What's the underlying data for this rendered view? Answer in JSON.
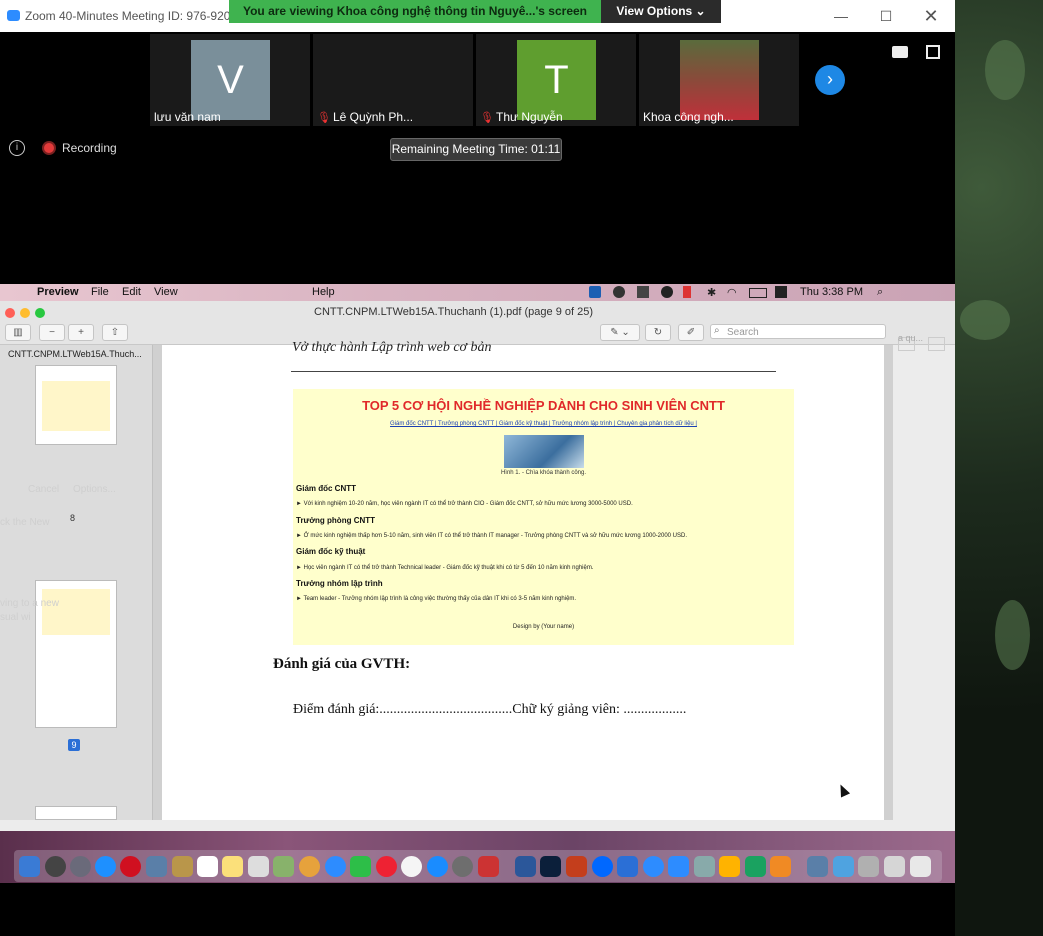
{
  "zoom": {
    "window_title": "Zoom 40-Minutes Meeting ID: 976-920",
    "viewing_banner": "You are viewing Khoa công nghệ thông tin Nguyê...'s screen",
    "view_options": "View Options ⌄",
    "participants": [
      {
        "initial": "V",
        "name": "lưu văn nam",
        "color": "#7a8f9a",
        "muted": false
      },
      {
        "initial": "",
        "name": "Lê Quỳnh Ph...",
        "color": "#1a1a1a",
        "muted": true
      },
      {
        "initial": "T",
        "name": "Thư Nguyễn",
        "color": "#5f9e2f",
        "muted": true
      },
      {
        "initial": "",
        "name": "Khoa công ngh...",
        "color": "#b33",
        "muted": false
      }
    ],
    "recording_label": "Recording",
    "remaining_time": "Remaining Meeting Time: 01:11",
    "next_icon": "chevron-right-icon"
  },
  "menubar": {
    "app": "Preview",
    "items": [
      "File",
      "Edit",
      "View",
      "Help"
    ],
    "clock": "Thu 3:38 PM"
  },
  "preview": {
    "title": "CNTT.CNPM.LTWeb15A.Thuchanh (1).pdf (page 9 of 25)",
    "search_placeholder": "Search",
    "sidebar_header": "CNTT.CNPM.LTWeb15A.Thuch...",
    "page_label_8": "8",
    "page_label_9": "9",
    "ghost": {
      "cancel": "Cancel",
      "options": "Options...",
      "new": "ck the New",
      "moving": "ving to a new",
      "visual": "sual wi"
    },
    "right_ghost": "a qu..."
  },
  "document": {
    "header": "Vở thực hành Lập trình web cơ bản",
    "box_title": "TOP 5 CƠ HỘI NGHỀ NGHIỆP DÀNH CHO SINH VIÊN CNTT",
    "box_links": "Giám đốc CNTT | Trưởng phòng CNTT | Giám đốc kỹ thuật | Trưởng nhóm lập trình | Chuyên gia phân tích dữ liệu |",
    "caption": "Hình 1. - Chìa khóa thành công.",
    "sections": [
      {
        "heading": "Giám đốc CNTT",
        "text": "► Với kinh nghiệm 10-20 năm, học viên ngành IT có thể trở thành CIO - Giám đốc CNTT, sở hữu mức lương 3000-5000 USD."
      },
      {
        "heading": "Trưởng phòng CNTT",
        "text": "► Ở mức kinh nghiệm thấp hơn 5-10 năm, sinh viên IT có thể trở thành IT manager - Trưởng phòng CNTT và sở hữu mức lương 1000-2000 USD."
      },
      {
        "heading": "Giám đốc kỹ thuật",
        "text": "► Học viên ngành IT có thể trở thành Technical leader - Giám đốc kỹ thuật khi có từ 5 đến 10 năm kinh nghiệm."
      },
      {
        "heading": "Trưởng nhóm lập trình",
        "text": "► Team leader - Trưởng nhóm lập trình là công việc thường thấy của dân IT khi có 3-5 năm kinh nghiệm."
      }
    ],
    "design_by": "Design by (Your name)",
    "eval_title": "Đánh giá của GVTH:",
    "eval_line": "Điểm đánh giá:......................................Chữ ký giảng viên: .................."
  }
}
